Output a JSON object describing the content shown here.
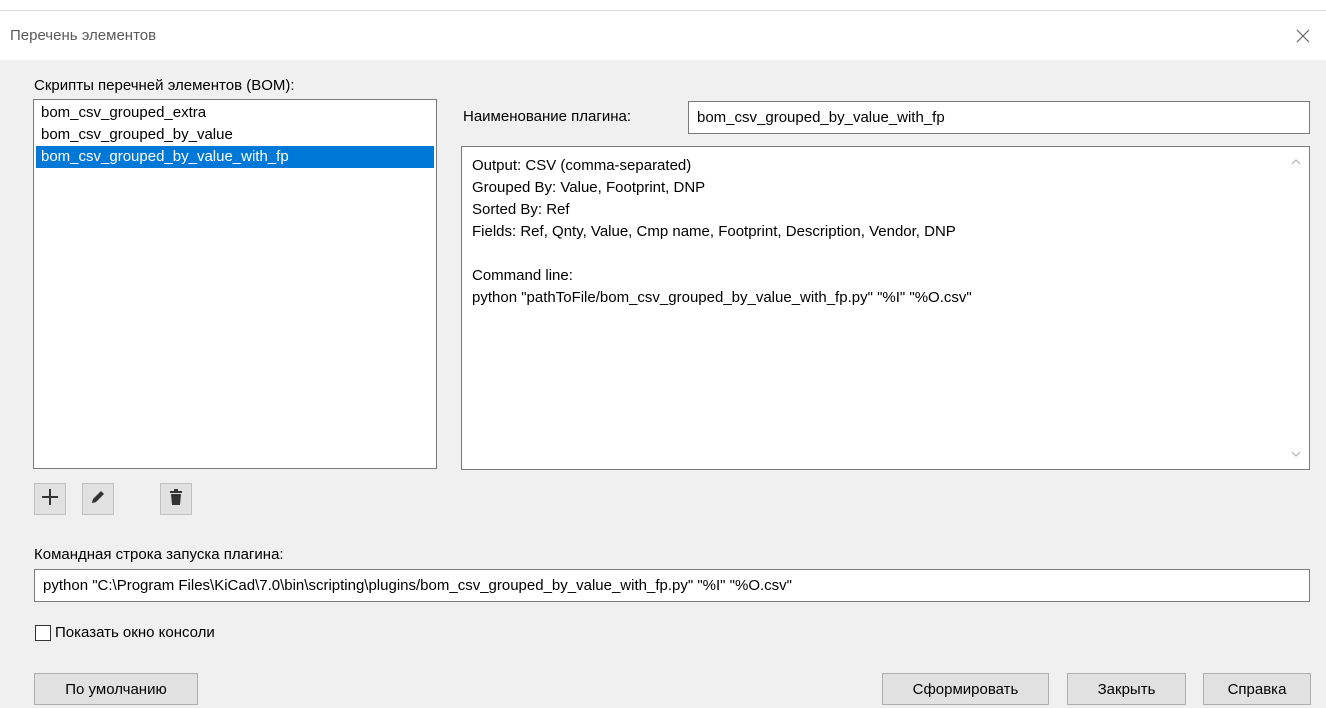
{
  "dialog": {
    "title": "Перечень элементов"
  },
  "scripts": {
    "label": "Скрипты перечней элементов (BOM):",
    "items": [
      {
        "label": "bom_csv_grouped_extra",
        "selected": false
      },
      {
        "label": "bom_csv_grouped_by_value",
        "selected": false
      },
      {
        "label": "bom_csv_grouped_by_value_with_fp",
        "selected": true
      }
    ]
  },
  "plugin": {
    "name_label": "Наименование плагина:",
    "name_value": "bom_csv_grouped_by_value_with_fp",
    "description": "Output: CSV (comma-separated)\nGrouped By: Value, Footprint, DNP\nSorted By: Ref\nFields: Ref, Qnty, Value, Cmp name, Footprint, Description, Vendor, DNP\n\nCommand line:\npython \"pathToFile/bom_csv_grouped_by_value_with_fp.py\" \"%I\" \"%O.csv\""
  },
  "toolbar": {
    "add_icon": "plus-icon",
    "edit_icon": "pencil-icon",
    "delete_icon": "trash-icon"
  },
  "command": {
    "label": "Командная строка запуска плагина:",
    "value": "python \"C:\\Program Files\\KiCad\\7.0\\bin\\scripting\\plugins/bom_csv_grouped_by_value_with_fp.py\" \"%I\" \"%O.csv\""
  },
  "console": {
    "label": "Показать окно консоли",
    "checked": false
  },
  "buttons": {
    "default": "По умолчанию",
    "generate": "Сформировать",
    "close": "Закрыть",
    "help": "Справка"
  }
}
